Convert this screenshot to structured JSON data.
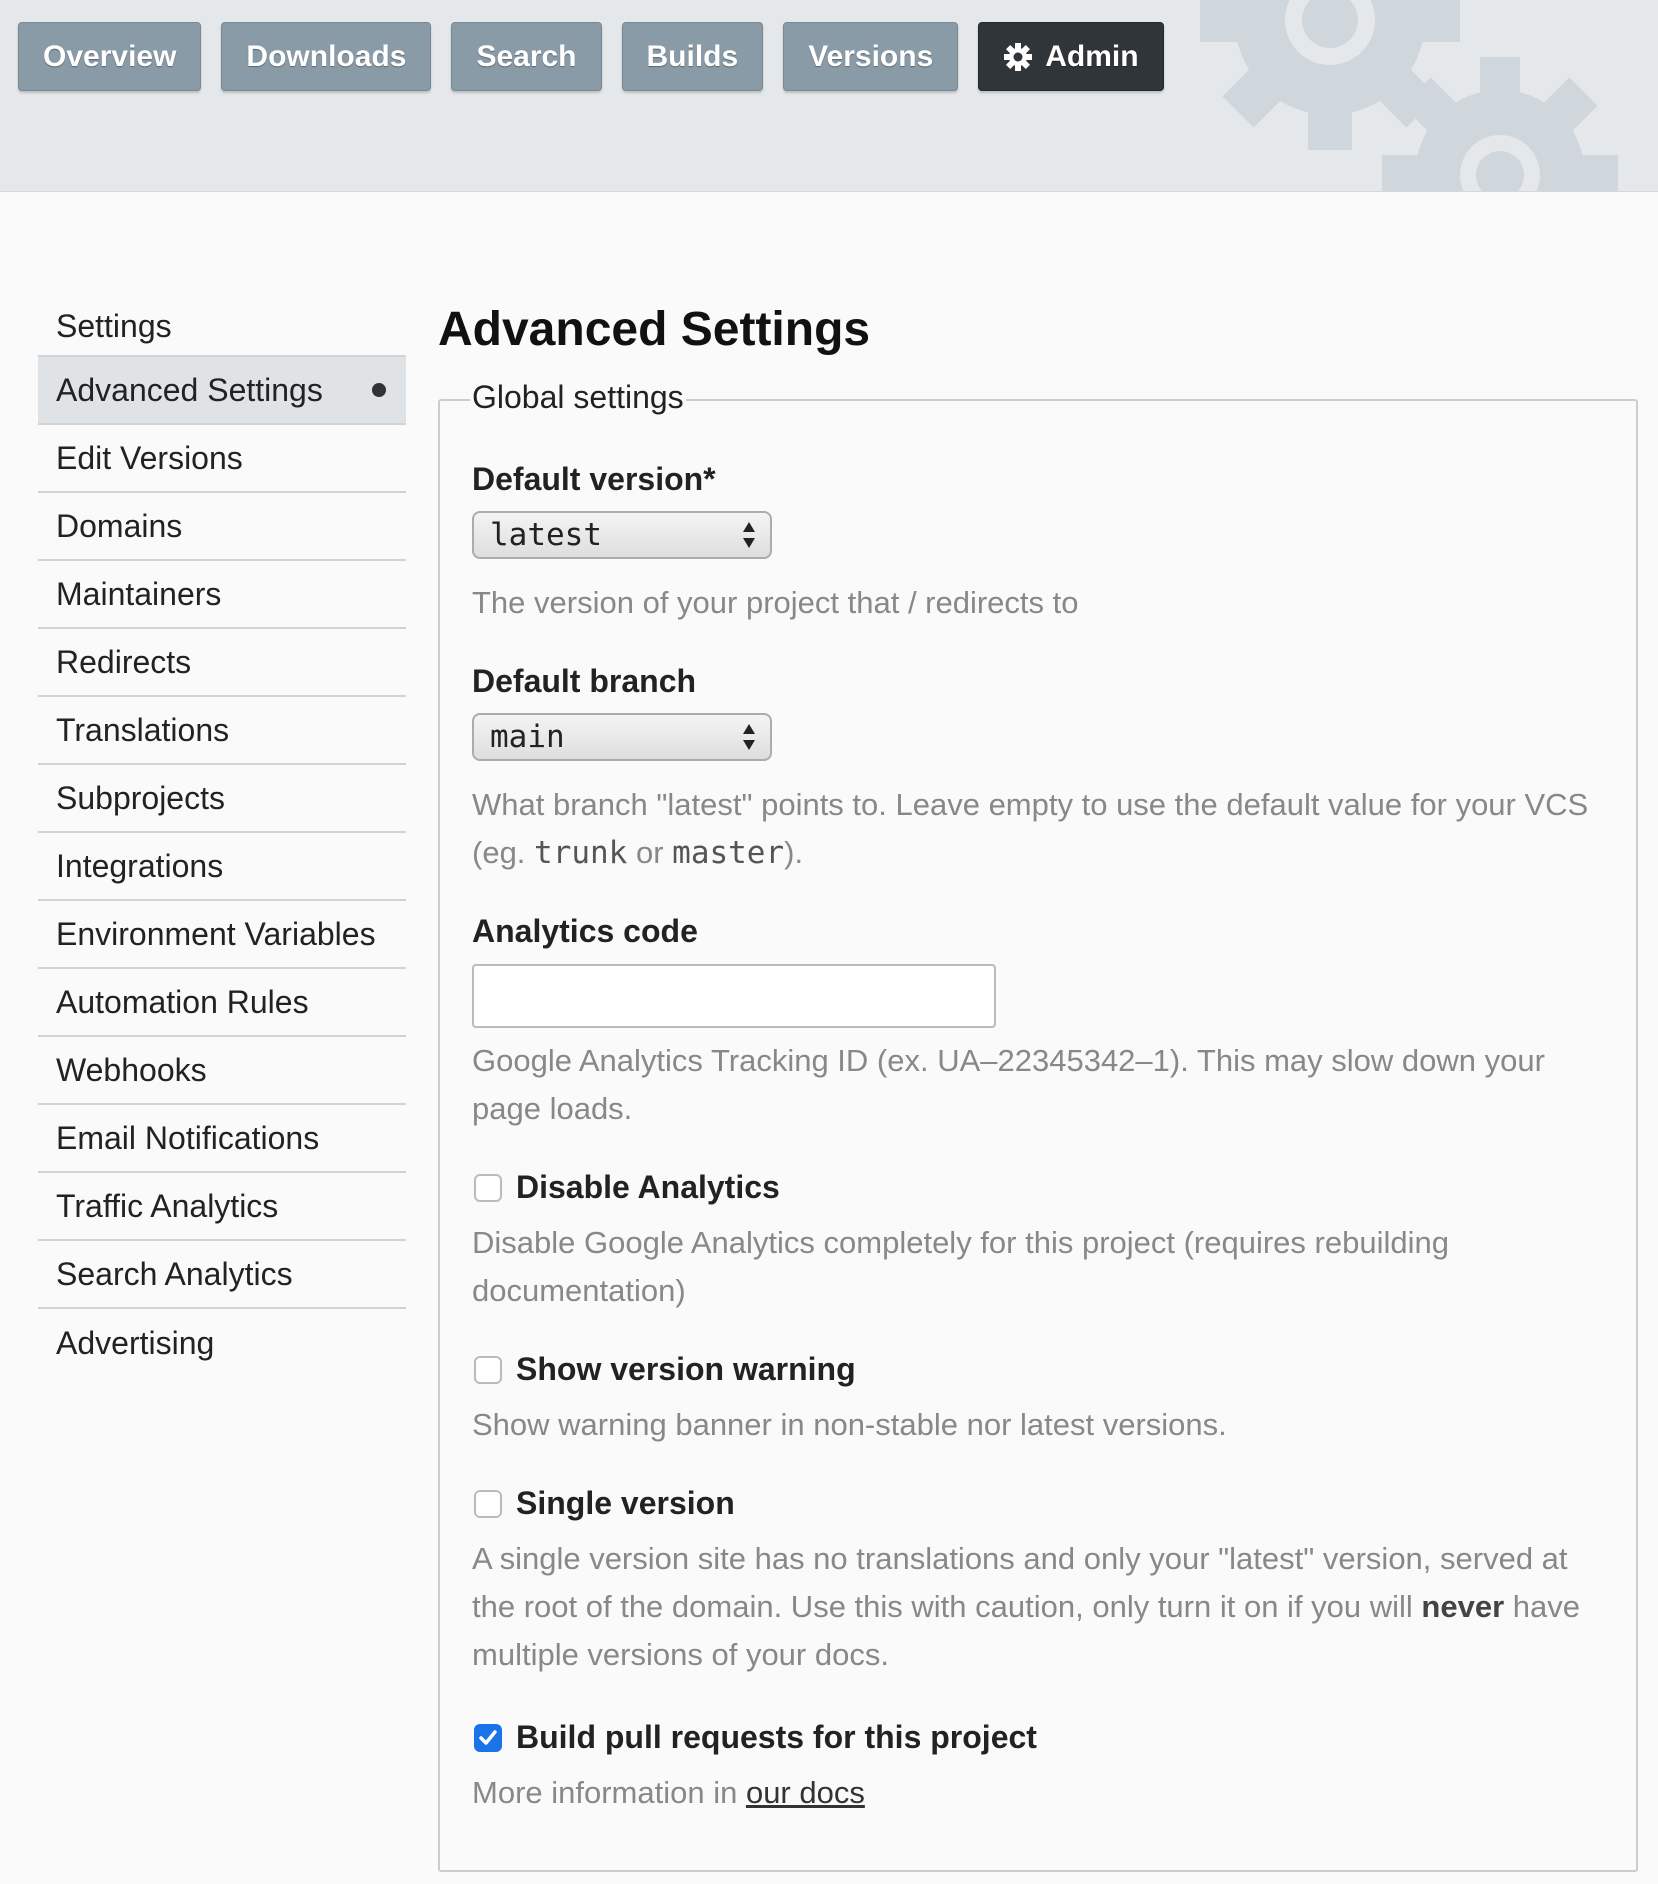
{
  "nav": {
    "items": [
      {
        "label": "Overview"
      },
      {
        "label": "Downloads"
      },
      {
        "label": "Search"
      },
      {
        "label": "Builds"
      },
      {
        "label": "Versions"
      },
      {
        "label": "Admin",
        "icon": "gear-icon",
        "active": true
      }
    ]
  },
  "sidebar": {
    "items": [
      {
        "label": "Settings"
      },
      {
        "label": "Advanced Settings",
        "current": true
      },
      {
        "label": "Edit Versions"
      },
      {
        "label": "Domains"
      },
      {
        "label": "Maintainers"
      },
      {
        "label": "Redirects"
      },
      {
        "label": "Translations"
      },
      {
        "label": "Subprojects"
      },
      {
        "label": "Integrations"
      },
      {
        "label": "Environment Variables"
      },
      {
        "label": "Automation Rules"
      },
      {
        "label": "Webhooks"
      },
      {
        "label": "Email Notifications"
      },
      {
        "label": "Traffic Analytics"
      },
      {
        "label": "Search Analytics"
      },
      {
        "label": "Advertising"
      }
    ]
  },
  "main": {
    "title": "Advanced Settings",
    "fieldset_legend": "Global settings",
    "default_version": {
      "label": "Default version*",
      "value": "latest",
      "help": "The version of your project that / redirects to"
    },
    "default_branch": {
      "label": "Default branch",
      "value": "main",
      "help_before": "What branch \"latest\" points to. Leave empty to use the default value for your VCS (eg. ",
      "code1": "trunk",
      "help_or": " or ",
      "code2": "master",
      "help_after": ")."
    },
    "analytics_code": {
      "label": "Analytics code",
      "value": "",
      "help": "Google Analytics Tracking ID (ex. UA–22345342–1). This may slow down your page loads."
    },
    "disable_analytics": {
      "label": "Disable Analytics",
      "checked": false,
      "help": "Disable Google Analytics completely for this project (requires rebuilding documentation)"
    },
    "show_version_warning": {
      "label": "Show version warning",
      "checked": false,
      "help": "Show warning banner in non-stable nor latest versions."
    },
    "single_version": {
      "label": "Single version",
      "checked": false,
      "help_before": "A single version site has no translations and only your \"latest\" version, served at the root of the domain. Use this with caution, only turn it on if you will ",
      "help_bold": "never",
      "help_after": " have multiple versions of your docs."
    },
    "build_pull_requests": {
      "label": "Build pull requests for this project",
      "checked": true,
      "help_before": "More information in ",
      "link": "our docs"
    }
  },
  "colors": {
    "nav_button": "#8a9ba8",
    "nav_active": "#2f3539",
    "checkbox_checked": "#1a73e8"
  }
}
